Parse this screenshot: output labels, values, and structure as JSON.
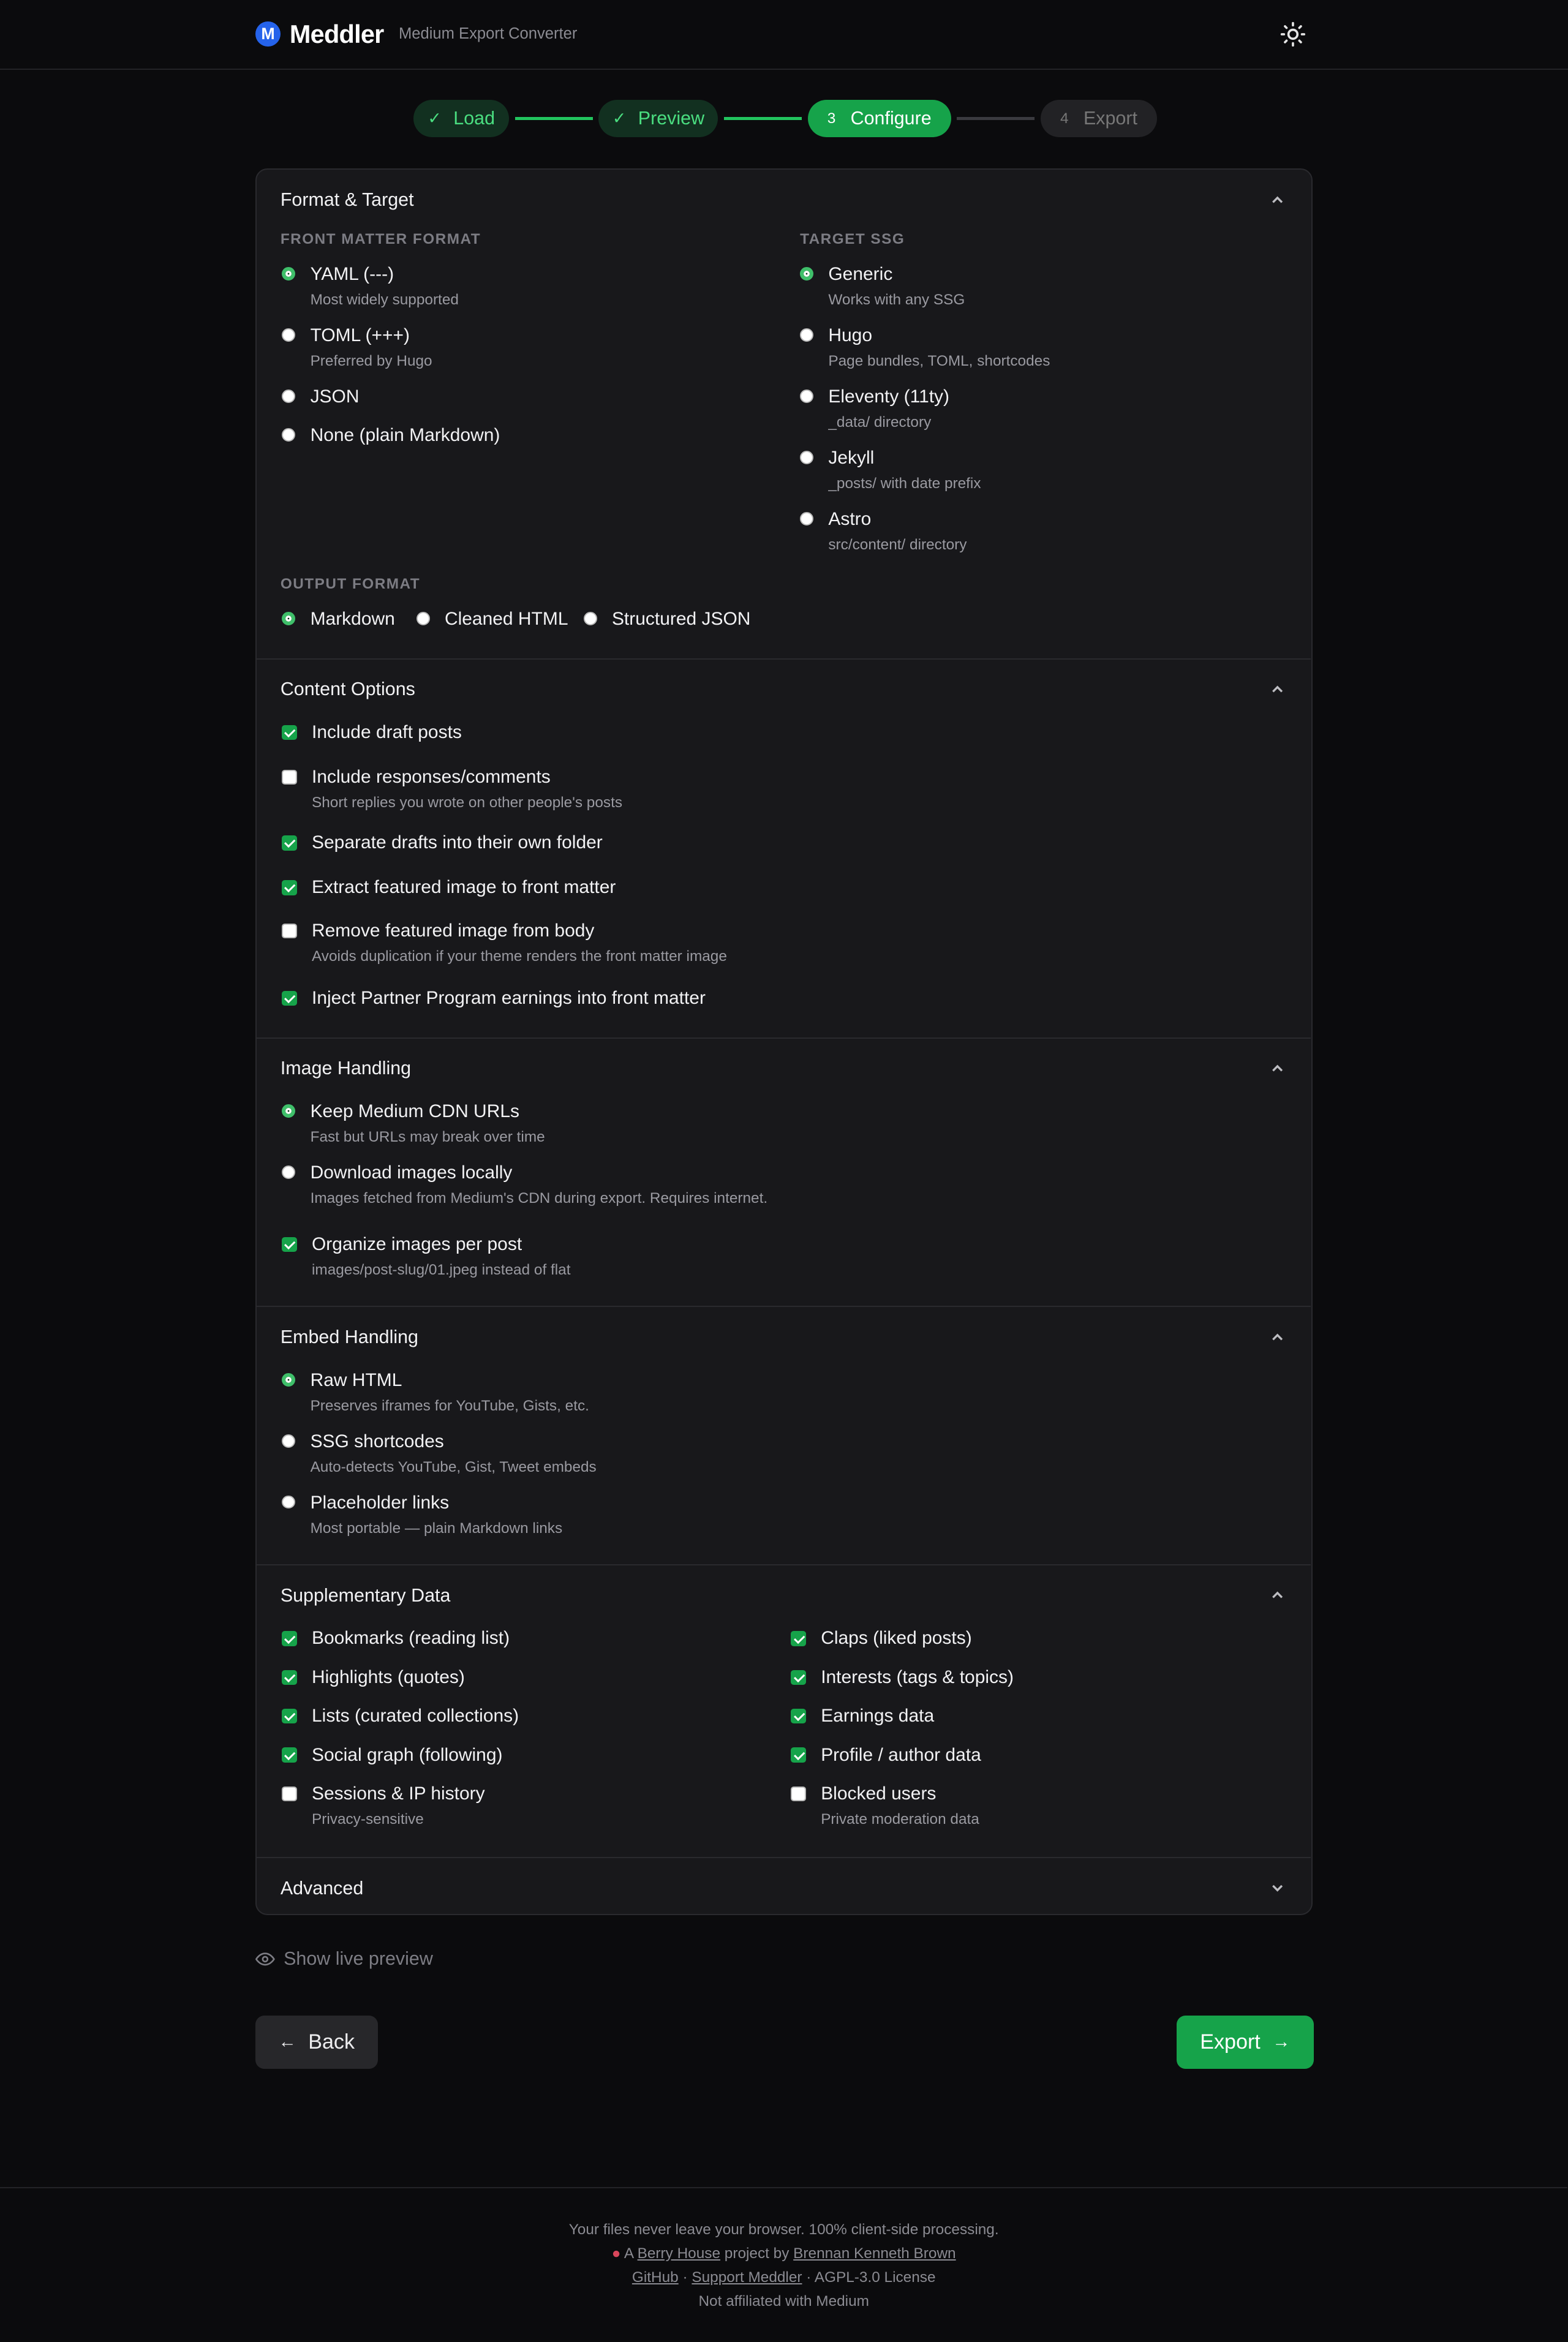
{
  "header": {
    "logo_letter": "M",
    "brand": "Meddler",
    "tagline": "Medium Export Converter"
  },
  "stepper": [
    {
      "label": "Load",
      "state": "done"
    },
    {
      "label": "Preview",
      "state": "done"
    },
    {
      "num": "3",
      "label": "Configure",
      "state": "active"
    },
    {
      "num": "4",
      "label": "Export",
      "state": "todo"
    }
  ],
  "sections": {
    "format": {
      "title": "Format & Target",
      "front_matter_caption": "Front Matter Format",
      "front_matter": [
        {
          "label": "YAML (---)",
          "desc": "Most widely supported",
          "selected": true
        },
        {
          "label": "TOML (+++)",
          "desc": "Preferred by Hugo",
          "selected": false
        },
        {
          "label": "JSON",
          "desc": "",
          "selected": false
        },
        {
          "label": "None (plain Markdown)",
          "desc": "",
          "selected": false
        }
      ],
      "target_caption": "Target SSG",
      "target": [
        {
          "label": "Generic",
          "desc": "Works with any SSG",
          "selected": true
        },
        {
          "label": "Hugo",
          "desc": "Page bundles, TOML, shortcodes",
          "selected": false
        },
        {
          "label": "Eleventy (11ty)",
          "desc": "_data/ directory",
          "selected": false
        },
        {
          "label": "Jekyll",
          "desc": "_posts/ with date prefix",
          "selected": false
        },
        {
          "label": "Astro",
          "desc": "src/content/ directory",
          "selected": false
        }
      ],
      "output_caption": "Output Format",
      "output": [
        {
          "label": "Markdown",
          "selected": true
        },
        {
          "label": "Cleaned HTML",
          "selected": false
        },
        {
          "label": "Structured JSON",
          "selected": false
        }
      ]
    },
    "content": {
      "title": "Content Options",
      "options": [
        {
          "label": "Include draft posts",
          "desc": "",
          "checked": true
        },
        {
          "label": "Include responses/comments",
          "desc": "Short replies you wrote on other people's posts",
          "checked": false
        },
        {
          "label": "Separate drafts into their own folder",
          "desc": "",
          "checked": true
        },
        {
          "label": "Extract featured image to front matter",
          "desc": "",
          "checked": true
        },
        {
          "label": "Remove featured image from body",
          "desc": "Avoids duplication if your theme renders the front matter image",
          "checked": false
        },
        {
          "label": "Inject Partner Program earnings into front matter",
          "desc": "",
          "checked": true
        }
      ]
    },
    "images": {
      "title": "Image Handling",
      "options": [
        {
          "label": "Keep Medium CDN URLs",
          "desc": "Fast but URLs may break over time",
          "selected": true
        },
        {
          "label": "Download images locally",
          "desc": "Images fetched from Medium's CDN during export. Requires internet.",
          "selected": false
        }
      ],
      "organize": {
        "label": "Organize images per post",
        "desc": "images/post-slug/01.jpeg instead of flat",
        "checked": true
      }
    },
    "embeds": {
      "title": "Embed Handling",
      "options": [
        {
          "label": "Raw HTML",
          "desc": "Preserves iframes for YouTube, Gists, etc.",
          "selected": true
        },
        {
          "label": "SSG shortcodes",
          "desc": "Auto-detects YouTube, Gist, Tweet embeds",
          "selected": false
        },
        {
          "label": "Placeholder links",
          "desc": "Most portable — plain Markdown links",
          "selected": false
        }
      ]
    },
    "supplementary": {
      "title": "Supplementary Data",
      "left": [
        {
          "label": "Bookmarks (reading list)",
          "desc": "",
          "checked": true
        },
        {
          "label": "Highlights (quotes)",
          "desc": "",
          "checked": true
        },
        {
          "label": "Lists (curated collections)",
          "desc": "",
          "checked": true
        },
        {
          "label": "Social graph (following)",
          "desc": "",
          "checked": true
        },
        {
          "label": "Sessions & IP history",
          "desc": "Privacy-sensitive",
          "checked": false
        }
      ],
      "right": [
        {
          "label": "Claps (liked posts)",
          "desc": "",
          "checked": true
        },
        {
          "label": "Interests (tags & topics)",
          "desc": "",
          "checked": true
        },
        {
          "label": "Earnings data",
          "desc": "",
          "checked": true
        },
        {
          "label": "Profile / author data",
          "desc": "",
          "checked": true
        },
        {
          "label": "Blocked users",
          "desc": "Private moderation data",
          "checked": false
        }
      ]
    },
    "advanced": {
      "title": "Advanced"
    }
  },
  "controls": {
    "live_preview": "Show live preview",
    "back": "Back",
    "export": "Export"
  },
  "footer": {
    "line1": "Your files never leave your browser. 100% client-side processing.",
    "line2_prefix": "A",
    "line2_house": "Berry House",
    "line2_mid": "project by",
    "line2_author": "Brennan Kenneth Brown",
    "github": "GitHub",
    "support": "Support Meddler",
    "license": "· AGPL-3.0 License",
    "sep": "·",
    "line4": "Not affiliated with Medium"
  },
  "colors": {
    "accent": "#16a34a",
    "background": "#0b0b0d",
    "card": "#18181b"
  }
}
